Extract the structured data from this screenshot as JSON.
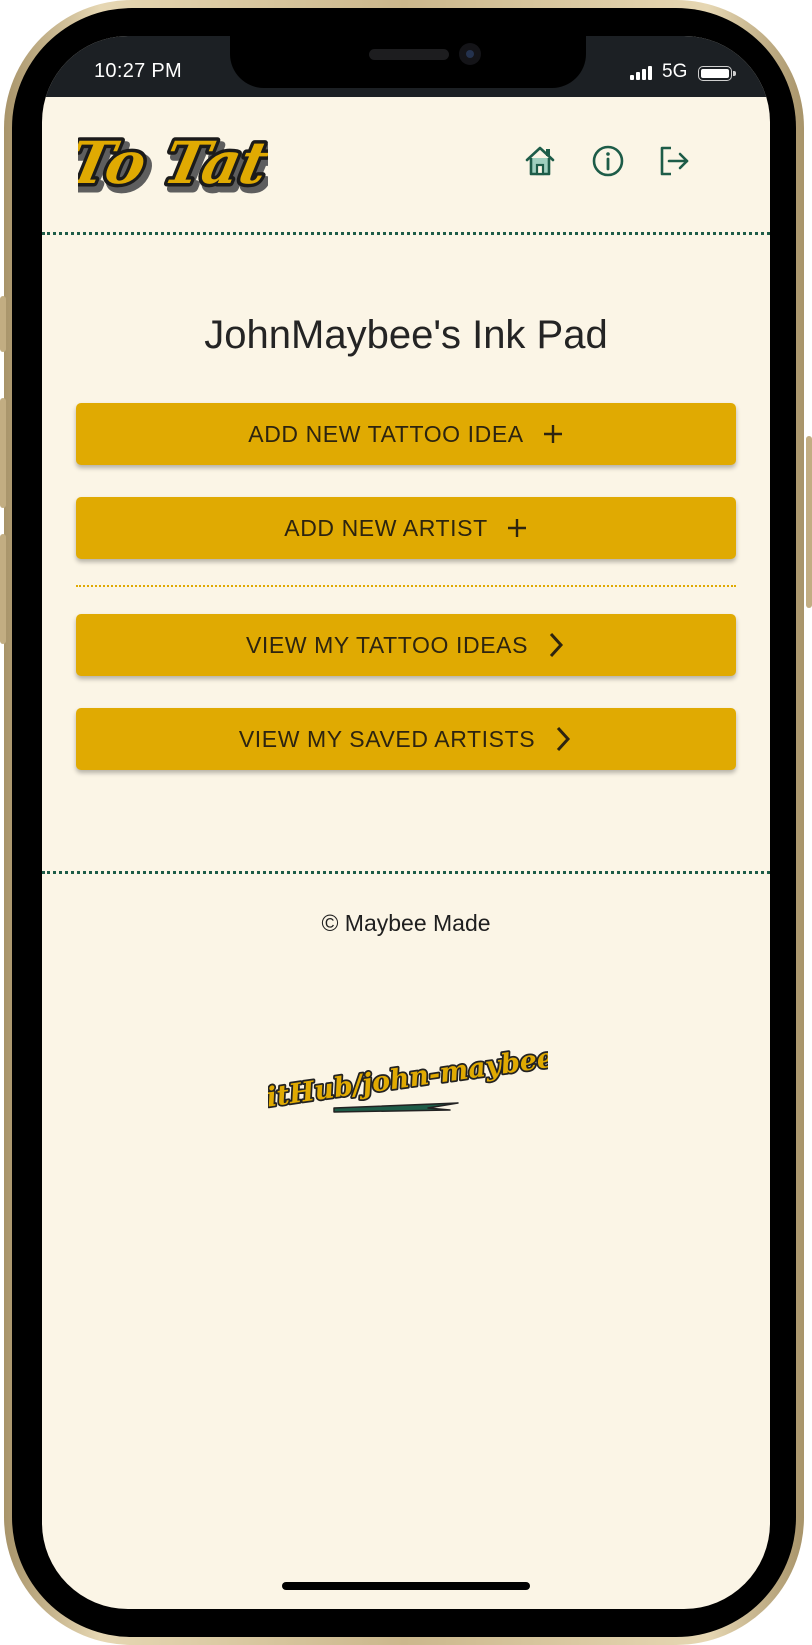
{
  "status_bar": {
    "time": "10:27 PM",
    "network": "5G",
    "icons": [
      "signal-icon",
      "battery-icon"
    ]
  },
  "header": {
    "logo_text": "To Tat",
    "nav_icons": [
      "home-icon",
      "info-icon",
      "logout-icon"
    ]
  },
  "main": {
    "title": "JohnMaybee's Ink Pad",
    "buttons": [
      {
        "label": "ADD NEW TATTOO IDEA",
        "icon": "plus-icon"
      },
      {
        "label": "ADD NEW ARTIST",
        "icon": "plus-icon"
      },
      {
        "label": "VIEW MY TATTOO IDEAS",
        "icon": "chevron-right-icon"
      },
      {
        "label": "VIEW MY SAVED ARTISTS",
        "icon": "chevron-right-icon"
      }
    ]
  },
  "footer": {
    "copyright": "© Maybee Made",
    "github_text": "GitHub/john-maybee"
  },
  "colors": {
    "background": "#fbf5e6",
    "accent_gold": "#e0aa02",
    "accent_green": "#1d5c48",
    "status_bar": "#1c2024"
  }
}
